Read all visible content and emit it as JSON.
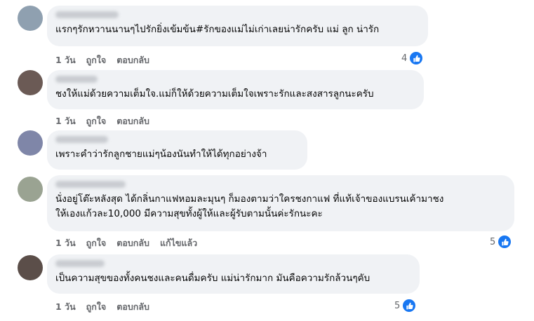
{
  "actions": {
    "time_1d": "1 วัน",
    "like": "ถูกใจ",
    "reply": "ตอบกลับ",
    "edited": "แก้ไขแล้ว"
  },
  "comments": [
    {
      "text": "แรกๆรักหวานนานๆไปรักยิ่งเข้มข้น#รักของแม่ไม่เก่าเลยน่ารักครับ แม่ ลูก น่ารัก",
      "reaction_count": "4",
      "avatar_color": "#8fa0b0"
    },
    {
      "text": "ชงให้แม่ด้วยความเต็มใจ.แม่ก็ให้ด้วยความเต็มใจเพราะรักและสงสารลูกนะครับ",
      "reaction_count": "",
      "avatar_color": "#6b5a55"
    },
    {
      "text": "เพราะคำว่ารักลูกชายแม่ๆน้องนันทำให้ได้ทุกอย่างจ้า",
      "reaction_count": "",
      "avatar_color": "#7f86a8"
    },
    {
      "text": "นั่งอยู่โต๊ะหลังสุด ได้กลิ่นกาแฟหอมละมุนๆ ก็มองตามว่าใครชงกาแฟ ที่แท้เจ้าของแบรนเค้ามาชง\nให้เองแก้วละ10,000 มีความสุขทั้งผู้ให้และผู้รับตามนั้นค่ะรักนะคะ",
      "reaction_count": "5",
      "avatar_color": "#9aa392"
    },
    {
      "text": "เป็นความสุขของทั้งคนชงและคนดื่มครับ แม่น่ารักมาก มันคือความรักล้วนๆคับ",
      "reaction_count": "5",
      "avatar_color": "#5b4e49"
    }
  ]
}
